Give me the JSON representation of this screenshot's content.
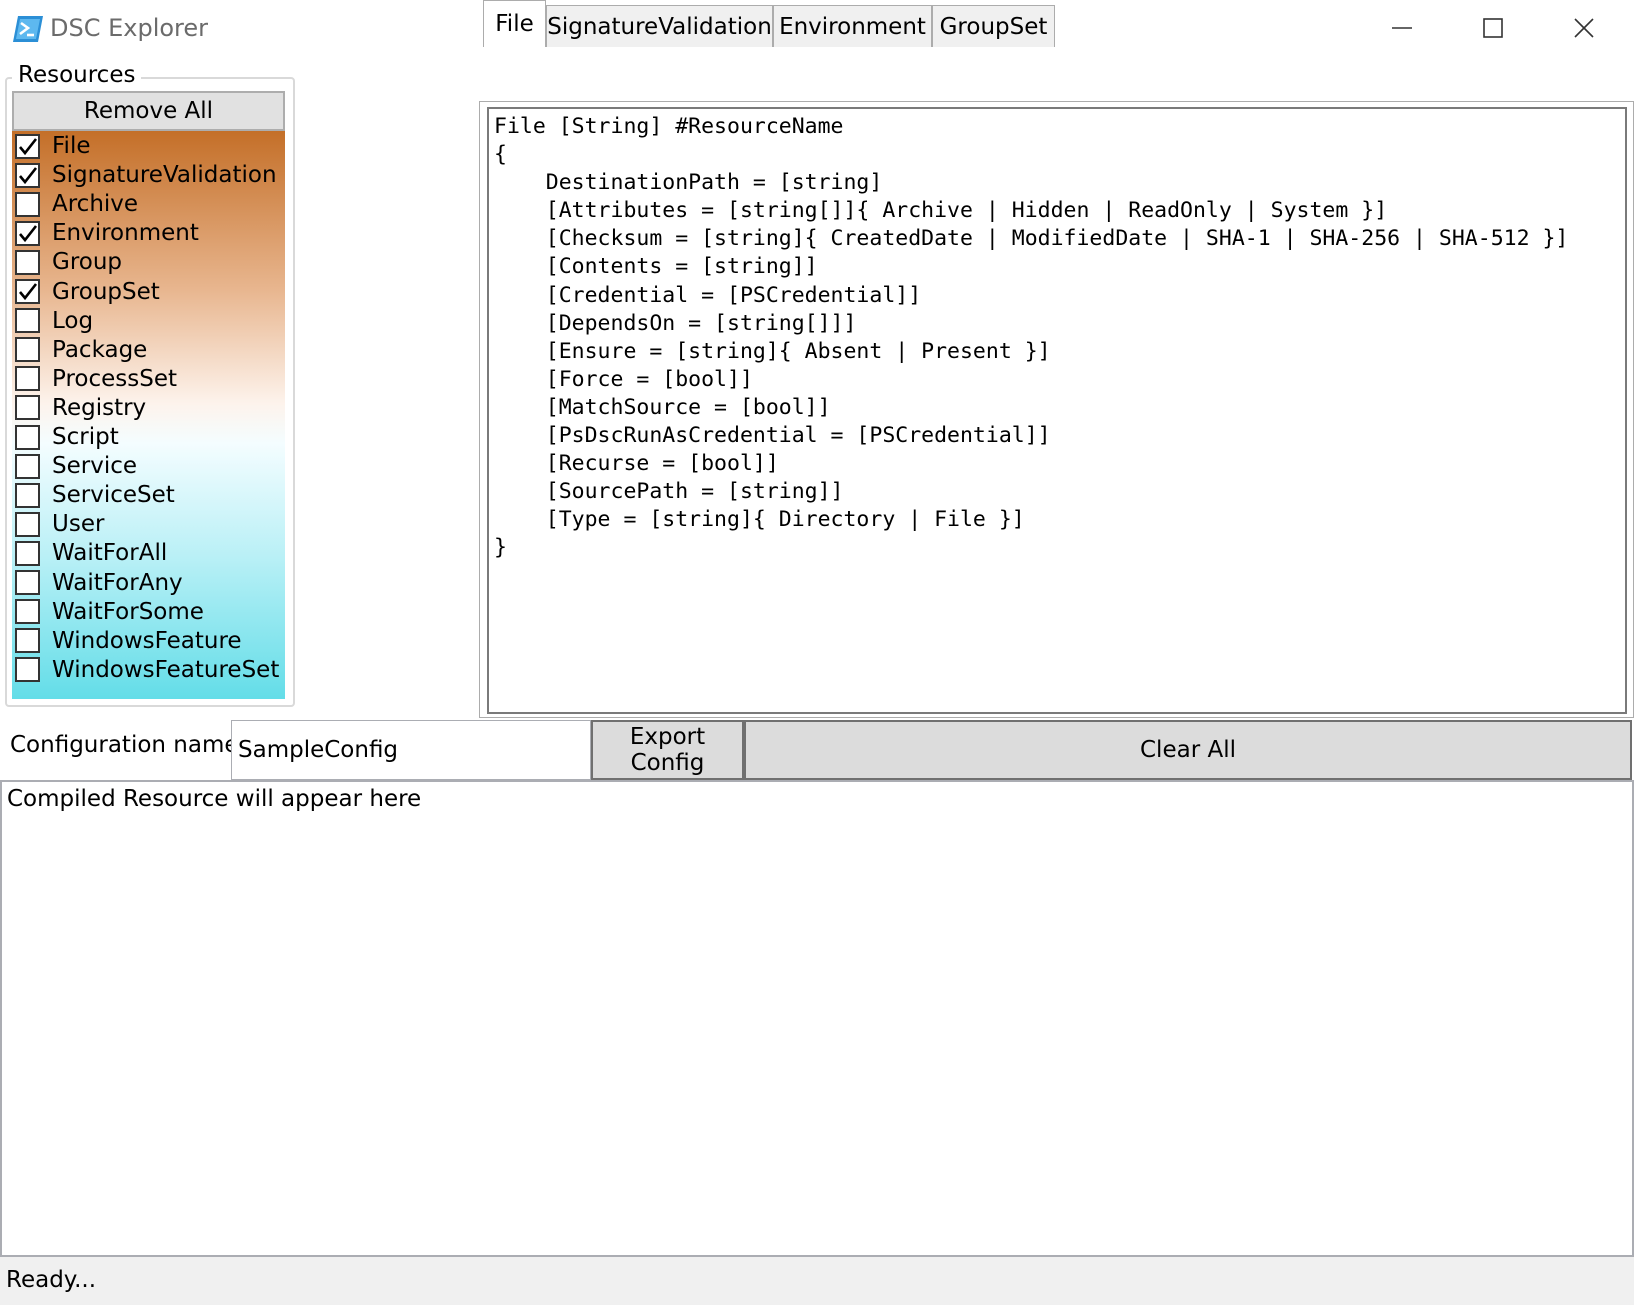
{
  "window": {
    "title": "DSC Explorer",
    "controls": [
      "minimize",
      "maximize",
      "close"
    ]
  },
  "resources": {
    "group_label": "Resources",
    "remove_all_label": "Remove All",
    "items": [
      {
        "label": "File",
        "checked": true
      },
      {
        "label": "SignatureValidation",
        "checked": true
      },
      {
        "label": "Archive",
        "checked": false
      },
      {
        "label": "Environment",
        "checked": true
      },
      {
        "label": "Group",
        "checked": false
      },
      {
        "label": "GroupSet",
        "checked": true
      },
      {
        "label": "Log",
        "checked": false
      },
      {
        "label": "Package",
        "checked": false
      },
      {
        "label": "ProcessSet",
        "checked": false
      },
      {
        "label": "Registry",
        "checked": false
      },
      {
        "label": "Script",
        "checked": false
      },
      {
        "label": "Service",
        "checked": false
      },
      {
        "label": "ServiceSet",
        "checked": false
      },
      {
        "label": "User",
        "checked": false
      },
      {
        "label": "WaitForAll",
        "checked": false
      },
      {
        "label": "WaitForAny",
        "checked": false
      },
      {
        "label": "WaitForSome",
        "checked": false
      },
      {
        "label": "WindowsFeature",
        "checked": false
      },
      {
        "label": "WindowsFeatureSet",
        "checked": false
      }
    ]
  },
  "tabs": {
    "items": [
      {
        "label": "File",
        "active": true
      },
      {
        "label": "SignatureValidation",
        "active": false
      },
      {
        "label": "Environment",
        "active": false
      },
      {
        "label": "GroupSet",
        "active": false
      }
    ],
    "code_lines": [
      "File [String] #ResourceName",
      "{",
      "    DestinationPath = [string]",
      "    [Attributes = [string[]]{ Archive | Hidden | ReadOnly | System }]",
      "    [Checksum = [string]{ CreatedDate | ModifiedDate | SHA-1 | SHA-256 | SHA-512 }]",
      "    [Contents = [string]]",
      "    [Credential = [PSCredential]]",
      "    [DependsOn = [string[]]]",
      "    [Ensure = [string]{ Absent | Present }]",
      "    [Force = [bool]]",
      "    [MatchSource = [bool]]",
      "    [PsDscRunAsCredential = [PSCredential]]",
      "    [Recurse = [bool]]",
      "    [SourcePath = [string]]",
      "    [Type = [string]{ Directory | File }]",
      "}"
    ]
  },
  "config": {
    "name_label": "Configuration name",
    "name_value": "SampleConfig",
    "export_label": "Export Config",
    "clear_label": "Clear All"
  },
  "output": {
    "text": "Compiled Resource will appear here"
  },
  "status": {
    "text": "Ready..."
  }
}
